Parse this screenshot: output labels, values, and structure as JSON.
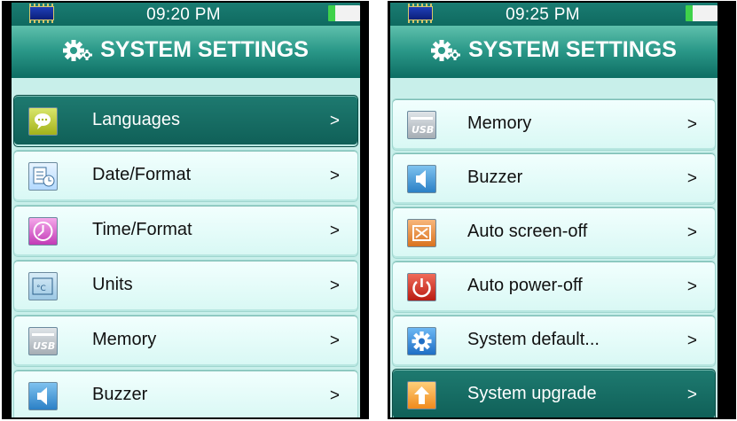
{
  "left": {
    "time": "09:20 PM",
    "title": "SYSTEM SETTINGS",
    "items": [
      {
        "label": "Languages",
        "arrow": ">"
      },
      {
        "label": "Date/Format",
        "arrow": ">"
      },
      {
        "label": "Time/Format",
        "arrow": ">"
      },
      {
        "label": "Units",
        "arrow": ">"
      },
      {
        "label": "Memory",
        "arrow": ">"
      },
      {
        "label": "Buzzer",
        "arrow": ">"
      }
    ],
    "selected_index": 0
  },
  "right": {
    "time": "09:25 PM",
    "title": "SYSTEM SETTINGS",
    "items": [
      {
        "label": "Memory",
        "arrow": ">"
      },
      {
        "label": "Buzzer",
        "arrow": ">"
      },
      {
        "label": "Auto  screen-off",
        "arrow": ">"
      },
      {
        "label": "Auto power-off",
        "arrow": ">"
      },
      {
        "label": "System default...",
        "arrow": ">"
      },
      {
        "label": "System upgrade",
        "arrow": ">"
      }
    ],
    "selected_index": 5
  },
  "icons": {
    "chip": "chip-icon",
    "battery": "battery-icon",
    "gear": "gear-icon",
    "languages": "speech-bubble-icon",
    "date": "calendar-icon",
    "time": "clock-icon",
    "units": "units-icon",
    "memory": "usb-icon",
    "buzzer": "speaker-icon",
    "auto_screen_off": "screen-off-icon",
    "auto_power_off": "power-icon",
    "system_default": "settings-icon",
    "system_upgrade": "upload-arrow-icon"
  },
  "colors": {
    "header_teal": "#0f6a60",
    "list_bg": "#c8efea",
    "selected_row": "#1e7a70"
  }
}
